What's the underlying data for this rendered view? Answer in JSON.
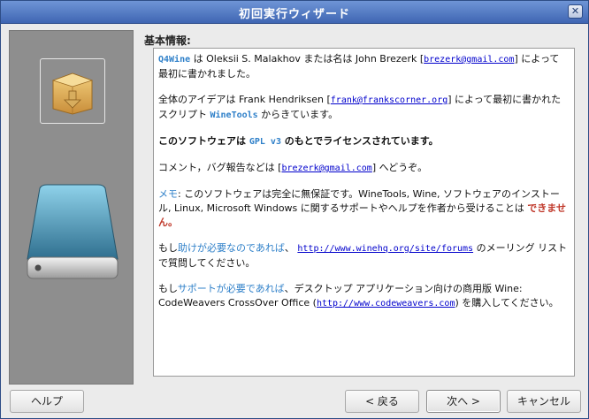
{
  "window": {
    "title": "初回実行ウィザード",
    "close_glyph": "✕"
  },
  "section": {
    "heading": "基本情報:"
  },
  "info": {
    "p1": {
      "q4wine": "Q4Wine",
      "t1": " は Oleksii S. Malakhov または名は John Brezerk [",
      "email": "brezerk@gmail.com",
      "t2": "] によって最初に書かれました。"
    },
    "p2": {
      "t1": "全体のアイデアは Frank Hendriksen [",
      "email": "frank@frankscorner.org",
      "t2": "] によって最初に書かれたスクリプト ",
      "winetools": "WineTools",
      "t3": " からきています。"
    },
    "p3": {
      "t1": "このソフトウェアは ",
      "gpl": "GPL v3",
      "t2": " のもとでライセンスされています。"
    },
    "p4": {
      "t1": "コメント，バグ報告などは [",
      "email": "brezerk@gmail.com",
      "t2": "] へどうぞ。"
    },
    "p5": {
      "memo": "メモ",
      "t1": ": このソフトウェアは完全に無保証です。WineTools, Wine, ソフトウェアのインストール, Linux, Microsoft Windows に関するサポートやヘルプを作者から受けることは ",
      "cannot": "できません。"
    },
    "p6": {
      "t1": "もし",
      "need_help": "助けが必要なのであれば",
      "t2": "、 ",
      "url": "http://www.winehq.org/site/forums",
      "t3": " のメーリング リストで質問してください。"
    },
    "p7": {
      "t1": "もし",
      "need_support": "サポートが必要であれば",
      "t2": "、デスクトップ アプリケーション向けの商用版 Wine: CodeWeavers CrossOver Office (",
      "url": "http://www.codeweavers.com",
      "t3": ") を購入してください。"
    }
  },
  "buttons": {
    "help": "ヘルプ",
    "back": "< 戻る",
    "next": "次へ >",
    "cancel": "キャンセル"
  },
  "icons": {
    "box": "package-icon",
    "drive": "hard-drive-icon"
  }
}
